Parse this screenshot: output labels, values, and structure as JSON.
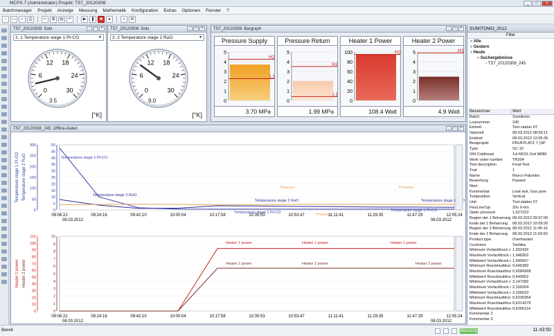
{
  "window": {
    "title": "MCPS 7     (Administrator)   Projekt: TS7_20120308"
  },
  "menu": [
    "Batchmanager",
    "Projekt",
    "Anzeige",
    "Messung",
    "Mathematik",
    "Konfiguration",
    "Extras",
    "Optionen",
    "Fenster",
    "?"
  ],
  "toolbar": {
    "icons": [
      "new-icon",
      "open-icon",
      "save-icon",
      "print-icon",
      "cut-icon",
      "copy-icon",
      "paste-icon",
      "undo-icon",
      "play-icon",
      "pause-icon",
      "stop-icon",
      "record-icon",
      "zoom-icon",
      "settings-icon"
    ]
  },
  "solo1": {
    "title": "TS7_20120308: Solo",
    "select": "1: 1 Temperature stage 1 Pt-CO",
    "ticks": [
      "0",
      "6",
      "12",
      "18",
      "24",
      "30"
    ],
    "value": "3.5",
    "unit": "[°K]"
  },
  "solo2": {
    "title": "TS7_20120308: Solo",
    "select": "2: 2 Temperature stage 2 RuO",
    "ticks": [
      "0",
      "6",
      "12",
      "18",
      "24",
      "30"
    ],
    "value": "9.0",
    "unit": "[°K]"
  },
  "bargraph": {
    "title": "TS7_20120308: Bargraph",
    "columns": [
      {
        "name": "Pressure Supply",
        "value": "3.70 MPa",
        "ticks": [
          "5",
          "4",
          "3",
          "2",
          "1",
          "0"
        ],
        "level": 0.74,
        "h": "H2",
        "l": "L1",
        "hv": 0.85,
        "lv": 0.45,
        "c1": "#f0a024",
        "c2": "#f7cf7c"
      },
      {
        "name": "Pressure Return",
        "value": "1.99 MPa",
        "ticks": [
          "5",
          "4",
          "3",
          "2",
          "1",
          "0"
        ],
        "level": 0.398,
        "h": "H2",
        "l": "L1",
        "hv": 0.7,
        "lv": 0.08,
        "c1": "#f7c9a8",
        "c2": "#fbe6d6"
      },
      {
        "name": "Heater 1 Power",
        "value": "108.4 Watt",
        "ticks": [
          "100",
          "80",
          "60",
          "40",
          "20",
          "0"
        ],
        "level": 0.95,
        "h": "H1",
        "l": "",
        "hv": 0.95,
        "lv": -1,
        "c1": "#d93a2e",
        "c2": "#e96a5a"
      },
      {
        "name": "Heater 2 Power",
        "value": "4.9 Watt",
        "ticks": [
          "5",
          "4",
          "3",
          "2",
          "1",
          "0"
        ],
        "level": 0.49,
        "h": "H1",
        "l": "",
        "hv": 0.98,
        "lv": -1,
        "c1": "#7a2f2a",
        "c2": "#b47f7a"
      }
    ]
  },
  "offline": {
    "title": "TS7_20120308_245: Offline-Daten",
    "top_axes": {
      "left1_label": "Temperature stage 1 Pt-CO",
      "left1_ticks": [
        "0",
        "50",
        "100",
        "150",
        "200",
        "250",
        "300"
      ],
      "left2_label": "Temperature stage 2 RuO",
      "left2_ticks": [
        "0",
        "5",
        "10",
        "15",
        "20",
        "25",
        "30",
        "35",
        "40",
        "45",
        "50"
      ]
    },
    "bottom_axes": {
      "left1_label": "Heater 1 power",
      "left1_ticks": [
        "0",
        "10",
        "20",
        "30",
        "40",
        "50",
        "60",
        "70",
        "80",
        "90",
        "100",
        "110"
      ],
      "left2_label": "Heater 2 power",
      "left2_ticks": [
        "0",
        "1",
        "2",
        "3",
        "4",
        "5",
        "6",
        "7",
        "8",
        "9",
        "10"
      ]
    },
    "xticks": [
      "09:06:22",
      "09:24:16",
      "09:42:10",
      "10:00:04",
      "10:17:58",
      "10:35:53",
      "10:53:47",
      "11:11:41",
      "11:29:35",
      "11:47:29",
      "12:05:24"
    ],
    "xdate_start": "08.03.2012",
    "xdate_end": "08.03.2012",
    "labels_top": [
      "Temperature stage 1 Pt-CO",
      "Temperature stage 2 RuO",
      "Pressure",
      "Temperature stage 2 RuO",
      "Temperature stage 1 Pt-CO",
      "Pressure",
      "Temperature stage 1 Pt-CO",
      "Pressure",
      "Temperature stage 2 RuO"
    ],
    "labels_bottom": [
      "Heater 1 power",
      "Heater 1 power",
      "Heater 1 power",
      "Heater 2 power",
      "Heater 2 power",
      "Heater 2 power"
    ]
  },
  "chart_data": [
    {
      "type": "line",
      "title": "",
      "x": [
        "09:06:22",
        "09:24:16",
        "09:42:10",
        "10:00:04",
        "10:17:58",
        "10:35:53",
        "10:53:47",
        "11:11:41",
        "11:29:35",
        "11:47:29",
        "12:05:24"
      ],
      "series": [
        {
          "name": "Temperature stage 1 Pt-CO",
          "values": [
            285,
            60,
            10,
            3.8,
            3.6,
            3.5,
            3.5,
            3.5,
            3.5,
            3.5,
            3.5
          ]
        },
        {
          "name": "Temperature stage 2 RuO",
          "values": [
            48,
            22,
            7,
            8,
            19,
            18,
            16,
            15,
            13,
            13,
            12
          ]
        },
        {
          "name": "Pressure",
          "values": [
            24,
            25,
            26,
            25,
            23,
            24,
            25,
            25,
            25,
            25,
            25
          ]
        }
      ],
      "ylabel": "Temperature stage 1 Pt-CO",
      "ylim": [
        0,
        300
      ]
    },
    {
      "type": "line",
      "title": "",
      "x": [
        "09:06:22",
        "09:24:16",
        "09:42:10",
        "10:00:04",
        "10:17:58",
        "10:35:53",
        "10:53:47",
        "11:11:41",
        "11:29:35",
        "11:47:29",
        "12:05:24"
      ],
      "series": [
        {
          "name": "Heater 1 power",
          "values": [
            0,
            0,
            0,
            0,
            92,
            92,
            92,
            92,
            92,
            92,
            92
          ]
        },
        {
          "name": "Heater 2 power",
          "values": [
            0,
            0,
            0,
            0,
            63,
            63,
            63,
            63,
            63,
            63,
            63
          ]
        }
      ],
      "ylabel": "Heater 1 power",
      "ylim": [
        0,
        110
      ]
    }
  ],
  "sumitomo": {
    "title": "SUMITOMO_2012",
    "filter": "Filter",
    "tree": [
      "Alle",
      "Gestern",
      "Heute",
      "Suchergebnisse",
      "TS7_20120308_245"
    ]
  },
  "props": {
    "header_name": "Bezeichner",
    "header_value": "Wert",
    "rows": [
      [
        "Batch",
        "Sumitomo"
      ],
      [
        "Losnummer",
        "245"
      ],
      [
        "Einheit",
        "Test station 07"
      ],
      [
        "Startzeit",
        "08.03.2012 08:59:11"
      ],
      [
        "Endzeit",
        "08.03.2012 12:05:36"
      ],
      [
        "Besiprojekt",
        "PRÜFPLATZ 7 (SP"
      ],
      [
        "Type",
        "SC-10"
      ],
      [
        "S/N Coldhead",
        "1st M015 2nd M080"
      ],
      [
        "Work order number",
        "TR204"
      ],
      [
        "Test description",
        "Final-Test"
      ],
      [
        "Trial",
        "1"
      ],
      [
        "Name",
        "Marco Palumbo"
      ],
      [
        "Bewertung",
        "Passed"
      ],
      [
        "Wert",
        ""
      ],
      [
        "Kommentar",
        "Leak test, Gas pure"
      ],
      [
        "Testposition",
        "Vertical"
      ],
      [
        "Unit",
        "Test station 07"
      ],
      [
        "FlexLineTyp",
        "20x X-6m"
      ],
      [
        "Static pressure",
        "1,527223"
      ],
      [
        "Beginn der 1 Beharrung",
        "08.03.2012 09:57:06"
      ],
      [
        "Ende der 1 Beharrung",
        "08.03.2012 10:09:30"
      ],
      [
        "Beginn der 2 Beharrung",
        "08.03.2012 11:45:16"
      ],
      [
        "Ende der 2 Beharrung",
        "08.03.2012 11:59:50"
      ],
      [
        "Product type",
        "Overhauled"
      ],
      [
        "Customer",
        "Toshiba"
      ],
      [
        "Minimum Vorlaufdruck c1",
        "1,932432"
      ],
      [
        "Maximum Vorlaufdruck c1",
        "1,948302"
      ],
      [
        "Mittelwert Vorlaufdruck c1",
        "1,940607"
      ],
      [
        "Minimum Ruecklaufdruck c1",
        "0,646382"
      ],
      [
        "Maximum Ruecklaufdruck c1",
        "0,6584368"
      ],
      [
        "Mittelwert Ruecklaufdruck c1",
        "0,649952"
      ],
      [
        "Minimum Vorlaufdruck c2",
        "2,147282"
      ],
      [
        "Maximum Vorlaufdruck c2",
        "2,156204"
      ],
      [
        "Mittelwert Vorlaufdruck c2",
        "2,156023"
      ],
      [
        "Minimum Ruecklaufdruck c2",
        "0,6230354"
      ],
      [
        "Maximum Ruecklaufdruck c2",
        "0,6314279"
      ],
      [
        "Mittelwert Ruecklaufdruck c2",
        "0,6266114"
      ],
      [
        "Kommentar 2",
        ""
      ],
      [
        "Kommentar 3",
        ""
      ]
    ]
  },
  "status": {
    "left": "Bereit",
    "mess": "Messung",
    "clock": "11:43:50"
  }
}
